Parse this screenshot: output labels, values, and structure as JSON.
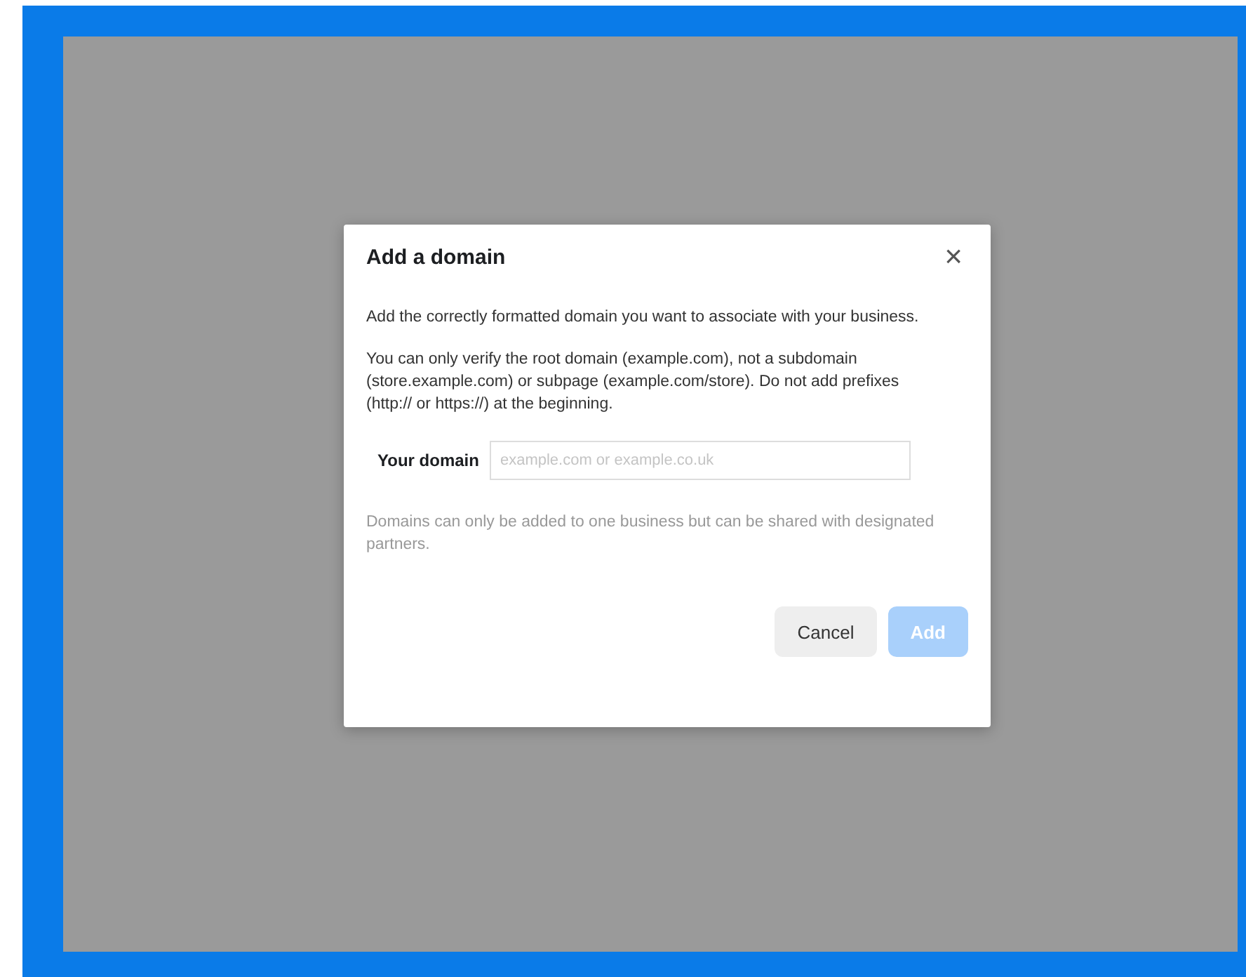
{
  "dialog": {
    "title": "Add a domain",
    "close_symbol": "×",
    "paragraphs": [
      "Add the correctly formatted domain you want to associate with your business.",
      "You can only verify the root domain (example.com), not a subdomain (store.example.com) or subpage (example.com/store). Do not add prefixes (http:// or https://) at the beginning."
    ],
    "field": {
      "label": "Your domain",
      "placeholder": "example.com or example.co.uk"
    },
    "note": "Domains can only be added to one business but can be shared with designated partners.",
    "buttons": [
      {
        "label": "Cancel",
        "kind": "secondary",
        "disabled": false
      },
      {
        "label": "Add",
        "kind": "primary",
        "disabled": true
      }
    ]
  }
}
